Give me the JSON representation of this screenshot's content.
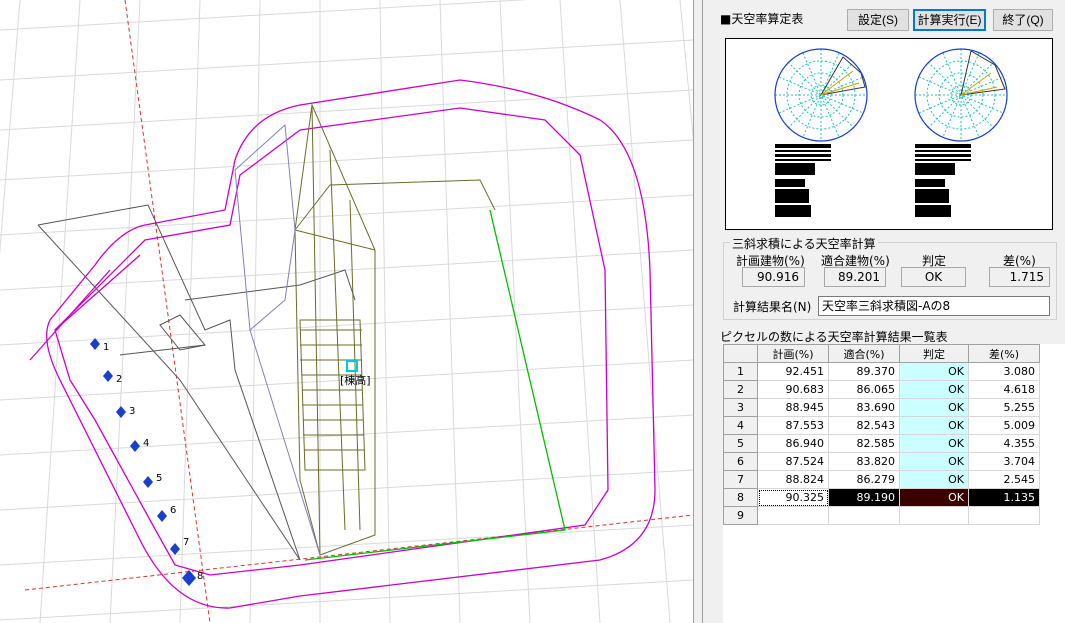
{
  "viewport": {
    "height_label": "[棟高]",
    "points": [
      "1",
      "2",
      "3",
      "4",
      "5",
      "6",
      "7",
      "8"
    ]
  },
  "panel": {
    "title": "■天空率算定表",
    "buttons": {
      "settings": "設定(S)",
      "run": "計算実行(E)",
      "quit": "終了(Q)"
    },
    "triangle": {
      "group_title": "三斜求積による天空率計算",
      "headers": {
        "plan": "計画建物(%)",
        "conform": "適合建物(%)",
        "judge": "判定",
        "diff": "差(%)"
      },
      "values": {
        "plan": "90.916",
        "conform": "89.201",
        "judge": "OK",
        "diff": "1.715"
      },
      "result_name_label": "計算結果名(N)",
      "result_name_value": "天空率三斜求積図-Aの8"
    },
    "pixel_table": {
      "title": "ピクセルの数による天空率計算結果一覧表",
      "columns": [
        "",
        "計画(%)",
        "適合(%)",
        "判定",
        "差(%)"
      ],
      "rows": [
        {
          "no": "1",
          "plan": "92.451",
          "conform": "89.370",
          "judge": "OK",
          "diff": "3.080"
        },
        {
          "no": "2",
          "plan": "90.683",
          "conform": "86.065",
          "judge": "OK",
          "diff": "4.618"
        },
        {
          "no": "3",
          "plan": "88.945",
          "conform": "83.690",
          "judge": "OK",
          "diff": "5.255"
        },
        {
          "no": "4",
          "plan": "87.553",
          "conform": "82.543",
          "judge": "OK",
          "diff": "5.009"
        },
        {
          "no": "5",
          "plan": "86.940",
          "conform": "82.585",
          "judge": "OK",
          "diff": "4.355"
        },
        {
          "no": "6",
          "plan": "87.524",
          "conform": "83.820",
          "judge": "OK",
          "diff": "3.704"
        },
        {
          "no": "7",
          "plan": "88.824",
          "conform": "86.279",
          "judge": "OK",
          "diff": "2.545"
        },
        {
          "no": "8",
          "plan": "90.325",
          "conform": "89.190",
          "judge": "OK",
          "diff": "1.135"
        },
        {
          "no": "9",
          "plan": "",
          "conform": "",
          "judge": "",
          "diff": ""
        }
      ],
      "selected_row": 8
    }
  },
  "colors": {
    "judge_ok_bg": "#ccffff",
    "offset_line": "#cc00cc",
    "site_line": "#00cc00",
    "building": "#6b6b2a",
    "point_marker": "#1a3fcf"
  }
}
